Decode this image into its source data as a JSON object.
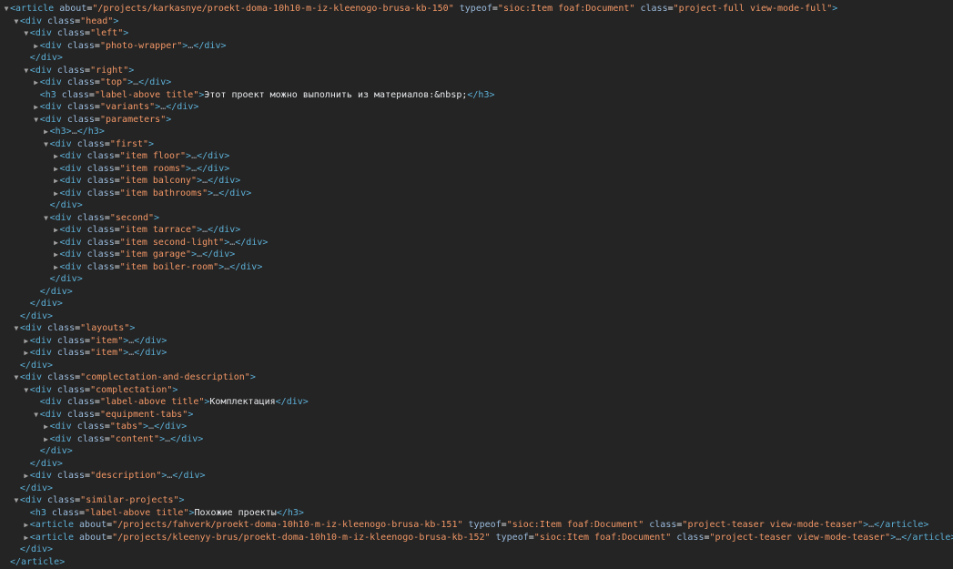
{
  "page": {
    "background": "#242424"
  },
  "colors": {
    "tag": "#5db0d7",
    "attr_name": "#9bbbdc",
    "attr_value": "#f29766",
    "text": "#e8eaed",
    "ellipsis": "#9aa0a6",
    "toggle": "#a0a0a0"
  },
  "icons": {
    "expanded": "triangle-down-icon",
    "collapsed": "triangle-right-icon"
  },
  "rows": [
    {
      "depth": 0,
      "toggle": "open",
      "kind": "open",
      "tag": "article",
      "attrs": [
        {
          "name": "about",
          "value": "/projects/karkasnye/proekt-doma-10h10-m-iz-kleenogo-brusa-kb-150"
        },
        {
          "name": "typeof",
          "value": "sioc:Item foaf:Document"
        },
        {
          "name": "class",
          "value": "project-full view-mode-full"
        }
      ]
    },
    {
      "depth": 1,
      "toggle": "open",
      "kind": "open",
      "tag": "div",
      "attrs": [
        {
          "name": "class",
          "value": "head"
        }
      ]
    },
    {
      "depth": 2,
      "toggle": "open",
      "kind": "open",
      "tag": "div",
      "attrs": [
        {
          "name": "class",
          "value": "left"
        }
      ]
    },
    {
      "depth": 3,
      "toggle": "closed",
      "kind": "collapsed",
      "tag": "div",
      "attrs": [
        {
          "name": "class",
          "value": "photo-wrapper"
        }
      ]
    },
    {
      "depth": 2,
      "toggle": "none",
      "kind": "close",
      "tag": "div"
    },
    {
      "depth": 2,
      "toggle": "open",
      "kind": "open",
      "tag": "div",
      "attrs": [
        {
          "name": "class",
          "value": "right"
        }
      ]
    },
    {
      "depth": 3,
      "toggle": "closed",
      "kind": "collapsed",
      "tag": "div",
      "attrs": [
        {
          "name": "class",
          "value": "top"
        }
      ]
    },
    {
      "depth": 3,
      "toggle": "none",
      "kind": "inline",
      "tag": "h3",
      "attrs": [
        {
          "name": "class",
          "value": "label-above title"
        }
      ],
      "text": "Этот проект можно выполнить из материалов:&nbsp;"
    },
    {
      "depth": 3,
      "toggle": "closed",
      "kind": "collapsed",
      "tag": "div",
      "attrs": [
        {
          "name": "class",
          "value": "variants"
        }
      ]
    },
    {
      "depth": 3,
      "toggle": "open",
      "kind": "open",
      "tag": "div",
      "attrs": [
        {
          "name": "class",
          "value": "parameters"
        }
      ]
    },
    {
      "depth": 4,
      "toggle": "closed",
      "kind": "collapsed",
      "tag": "h3",
      "attrs": []
    },
    {
      "depth": 4,
      "toggle": "open",
      "kind": "open",
      "tag": "div",
      "attrs": [
        {
          "name": "class",
          "value": "first"
        }
      ]
    },
    {
      "depth": 5,
      "toggle": "closed",
      "kind": "collapsed",
      "tag": "div",
      "attrs": [
        {
          "name": "class",
          "value": "item floor"
        }
      ]
    },
    {
      "depth": 5,
      "toggle": "closed",
      "kind": "collapsed",
      "tag": "div",
      "attrs": [
        {
          "name": "class",
          "value": "item rooms"
        }
      ]
    },
    {
      "depth": 5,
      "toggle": "closed",
      "kind": "collapsed",
      "tag": "div",
      "attrs": [
        {
          "name": "class",
          "value": "item balcony"
        }
      ]
    },
    {
      "depth": 5,
      "toggle": "closed",
      "kind": "collapsed",
      "tag": "div",
      "attrs": [
        {
          "name": "class",
          "value": "item bathrooms"
        }
      ]
    },
    {
      "depth": 4,
      "toggle": "none",
      "kind": "close",
      "tag": "div"
    },
    {
      "depth": 4,
      "toggle": "open",
      "kind": "open",
      "tag": "div",
      "attrs": [
        {
          "name": "class",
          "value": "second"
        }
      ]
    },
    {
      "depth": 5,
      "toggle": "closed",
      "kind": "collapsed",
      "tag": "div",
      "attrs": [
        {
          "name": "class",
          "value": "item tarrace"
        }
      ]
    },
    {
      "depth": 5,
      "toggle": "closed",
      "kind": "collapsed",
      "tag": "div",
      "attrs": [
        {
          "name": "class",
          "value": "item second-light"
        }
      ]
    },
    {
      "depth": 5,
      "toggle": "closed",
      "kind": "collapsed",
      "tag": "div",
      "attrs": [
        {
          "name": "class",
          "value": "item garage"
        }
      ]
    },
    {
      "depth": 5,
      "toggle": "closed",
      "kind": "collapsed",
      "tag": "div",
      "attrs": [
        {
          "name": "class",
          "value": "item boiler-room"
        }
      ]
    },
    {
      "depth": 4,
      "toggle": "none",
      "kind": "close",
      "tag": "div"
    },
    {
      "depth": 3,
      "toggle": "none",
      "kind": "close",
      "tag": "div"
    },
    {
      "depth": 2,
      "toggle": "none",
      "kind": "close",
      "tag": "div"
    },
    {
      "depth": 1,
      "toggle": "none",
      "kind": "close",
      "tag": "div"
    },
    {
      "depth": 1,
      "toggle": "open",
      "kind": "open",
      "tag": "div",
      "attrs": [
        {
          "name": "class",
          "value": "layouts"
        }
      ]
    },
    {
      "depth": 2,
      "toggle": "closed",
      "kind": "collapsed",
      "tag": "div",
      "attrs": [
        {
          "name": "class",
          "value": "item"
        }
      ]
    },
    {
      "depth": 2,
      "toggle": "closed",
      "kind": "collapsed",
      "tag": "div",
      "attrs": [
        {
          "name": "class",
          "value": "item"
        }
      ]
    },
    {
      "depth": 1,
      "toggle": "none",
      "kind": "close",
      "tag": "div"
    },
    {
      "depth": 1,
      "toggle": "open",
      "kind": "open",
      "tag": "div",
      "attrs": [
        {
          "name": "class",
          "value": "complectation-and-description"
        }
      ]
    },
    {
      "depth": 2,
      "toggle": "open",
      "kind": "open",
      "tag": "div",
      "attrs": [
        {
          "name": "class",
          "value": "complectation"
        }
      ]
    },
    {
      "depth": 3,
      "toggle": "none",
      "kind": "inline",
      "tag": "div",
      "attrs": [
        {
          "name": "class",
          "value": "label-above title"
        }
      ],
      "text": "Комплектация"
    },
    {
      "depth": 3,
      "toggle": "open",
      "kind": "open",
      "tag": "div",
      "attrs": [
        {
          "name": "class",
          "value": "equipment-tabs"
        }
      ]
    },
    {
      "depth": 4,
      "toggle": "closed",
      "kind": "collapsed",
      "tag": "div",
      "attrs": [
        {
          "name": "class",
          "value": "tabs"
        }
      ]
    },
    {
      "depth": 4,
      "toggle": "closed",
      "kind": "collapsed",
      "tag": "div",
      "attrs": [
        {
          "name": "class",
          "value": "content"
        }
      ]
    },
    {
      "depth": 3,
      "toggle": "none",
      "kind": "close",
      "tag": "div"
    },
    {
      "depth": 2,
      "toggle": "none",
      "kind": "close",
      "tag": "div"
    },
    {
      "depth": 2,
      "toggle": "closed",
      "kind": "collapsed",
      "tag": "div",
      "attrs": [
        {
          "name": "class",
          "value": "description"
        }
      ]
    },
    {
      "depth": 1,
      "toggle": "none",
      "kind": "close",
      "tag": "div"
    },
    {
      "depth": 1,
      "toggle": "open",
      "kind": "open",
      "tag": "div",
      "attrs": [
        {
          "name": "class",
          "value": "similar-projects"
        }
      ]
    },
    {
      "depth": 2,
      "toggle": "none",
      "kind": "inline",
      "tag": "h3",
      "attrs": [
        {
          "name": "class",
          "value": "label-above title"
        }
      ],
      "text": "Похожие проекты"
    },
    {
      "depth": 2,
      "toggle": "closed",
      "kind": "collapsed",
      "tag": "article",
      "attrs": [
        {
          "name": "about",
          "value": "/projects/fahverk/proekt-doma-10h10-m-iz-kleenogo-brusa-kb-151"
        },
        {
          "name": "typeof",
          "value": "sioc:Item foaf:Document"
        },
        {
          "name": "class",
          "value": "project-teaser view-mode-teaser"
        }
      ]
    },
    {
      "depth": 2,
      "toggle": "closed",
      "kind": "collapsed",
      "tag": "article",
      "attrs": [
        {
          "name": "about",
          "value": "/projects/kleenyy-brus/proekt-doma-10h10-m-iz-kleenogo-brusa-kb-152"
        },
        {
          "name": "typeof",
          "value": "sioc:Item foaf:Document"
        },
        {
          "name": "class",
          "value": "project-teaser view-mode-teaser"
        }
      ]
    },
    {
      "depth": 1,
      "toggle": "none",
      "kind": "close",
      "tag": "div"
    },
    {
      "depth": 0,
      "toggle": "none",
      "kind": "close",
      "tag": "article"
    }
  ]
}
